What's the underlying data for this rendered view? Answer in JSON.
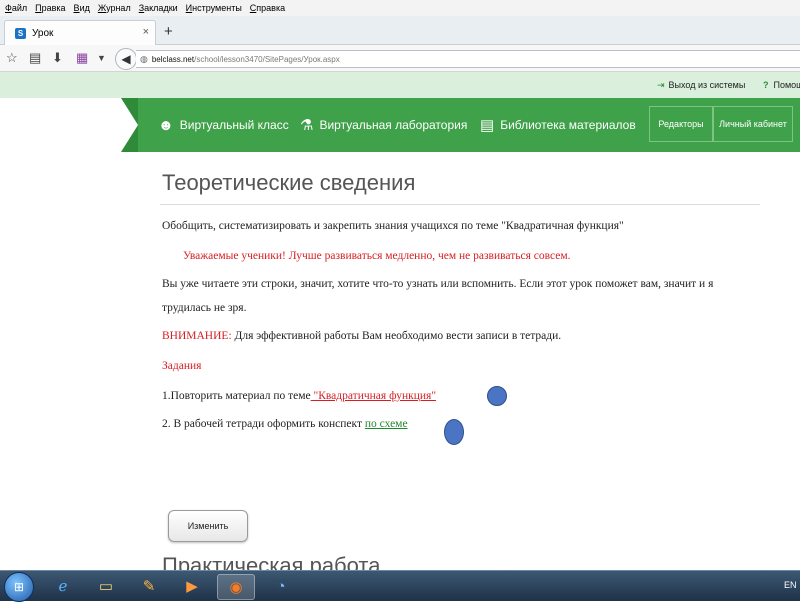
{
  "menu": [
    "Файл",
    "Правка",
    "Вид",
    "Журнал",
    "Закладки",
    "Инструменты",
    "Справка"
  ],
  "tab": {
    "title": "Урок",
    "close": "×"
  },
  "newtab": "+",
  "url": {
    "host": "belclass.net",
    "path": "/school/lesson3470/SitePages/Урок.aspx"
  },
  "strip": {
    "logout": "Выход из системы",
    "help": "Помощь"
  },
  "site_nav": {
    "items": [
      "Виртуальный класс",
      "Виртуальная лаборатория",
      "Библиотека материалов"
    ],
    "buttons": [
      "Редакторы",
      "Личный кабинет"
    ]
  },
  "content": {
    "heading": "Теоретические сведения",
    "intro": "Обобщить, систематизировать и закрепить знания учащихся по теме \"Квадратичная функция\"",
    "greeting": "Уважаемые ученики! Лучше развиваться медленно, чем не развиваться совсем.",
    "line1": "Вы уже читаете эти строки, значит, хотите что-то узнать или вспомнить. Если этот урок поможет вам, значит и я",
    "line2": "трудилась не зря.",
    "attention_label": "ВНИМАНИЕ:",
    "attention_text": " Для эффективной работы Вам необходимо вести записи в тетради.",
    "tasks_label": "Задания",
    "task1_text": "1.Повторить материал по теме",
    "task1_link": " \"Квадратичная функция\"",
    "task2_text": "2. В рабочей тетради оформить конспект ",
    "task2_link": "по схеме",
    "edit_button": "Изменить",
    "practical": "Практическая работа"
  },
  "taskbar": {
    "lang": "EN"
  },
  "colors": {
    "green": "#3fa14a",
    "red": "#d61f24",
    "link_green": "#1f8a2d",
    "marker_blue": "#4a74c4"
  }
}
